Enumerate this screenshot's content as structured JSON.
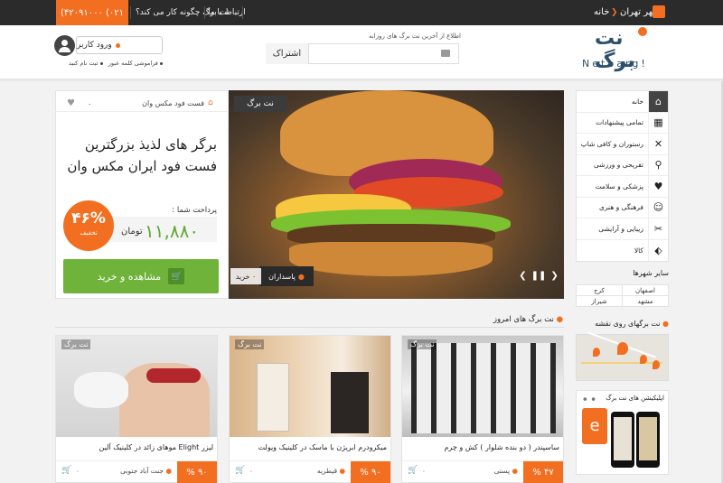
{
  "topbar": {
    "phone": "۰۲۱) ۴۲۰۹۱۰۰۰)",
    "contact": "ارتباط با ما",
    "how_it_works": "نت برگ چگونه کار می کند؟",
    "city": "شهر تهران",
    "home": "خانه"
  },
  "header": {
    "logo_text": "نت برگ",
    "logo_latin": "Netbarg!",
    "subscribe_note": "اطلاع از آخرین نت برگ های روزانه",
    "subscribe_button": "اشتراک",
    "login_button": "ورود کاربر",
    "register_link": "ثبت نام کنید",
    "forgot_link": "فراموشی کلمه عبور"
  },
  "sidebar": {
    "items": [
      {
        "label": "خانه",
        "icon": "home-icon"
      },
      {
        "label": "تمامی پیشنهادات",
        "icon": "grid-icon"
      },
      {
        "label": "رستوران و کافی شاپ",
        "icon": "cutlery-icon"
      },
      {
        "label": "تفریحی و ورزشی",
        "icon": "bicycle-icon"
      },
      {
        "label": "پزشکی و سلامت",
        "icon": "heartbeat-icon"
      },
      {
        "label": "فرهنگی و هنری",
        "icon": "masks-icon"
      },
      {
        "label": "زیبایی و آرایشی",
        "icon": "scissors-icon"
      },
      {
        "label": "کالا",
        "icon": "tag-icon"
      }
    ],
    "other_cities_title": "سایر شهرها",
    "cities": [
      [
        "اصفهان",
        "کرج"
      ],
      [
        "شیراز",
        "مشهد"
      ]
    ]
  },
  "deal": {
    "category": "فست فود مکس وان",
    "likes": "۰",
    "title": "برگر های لذیذ بزرگترین فست فود ایران مکس وان",
    "pay_label": "پرداخت شما :",
    "price": "۱۱,۸۸۰",
    "currency": "تومان",
    "discount": "۴۶%",
    "discount_label": "تخفیف",
    "buy_button": "مشاهده و خرید",
    "hero_brand": "نت برگ",
    "location": "پاسداران",
    "sold": "۰ خرید"
  },
  "today": {
    "title": "نت برگ های امروز",
    "cards": [
      {
        "title": "ساسپندر ( دو بنده شلوار ) کش و چرم",
        "discount": "۴۷ %",
        "location": "پستی",
        "count": "۰"
      },
      {
        "title": "میکرودرم ابریژن با ماسک در کلینیک ویولت",
        "discount": "۹۰ %",
        "location": "قیطریه",
        "count": "۰"
      },
      {
        "title": "لیزر Elight موهای زائد در کلینیک آلین",
        "discount": "۹۰ %",
        "location": "جنت آباد جنوبی",
        "count": "۰"
      }
    ]
  },
  "widgets": {
    "map_title": "نت برگهای روی نقشه",
    "app_title": "اپلیکیشن های نت برگ"
  },
  "colors": {
    "accent": "#f26f21",
    "green": "#6fb33a",
    "dark": "#2b2b2b"
  }
}
